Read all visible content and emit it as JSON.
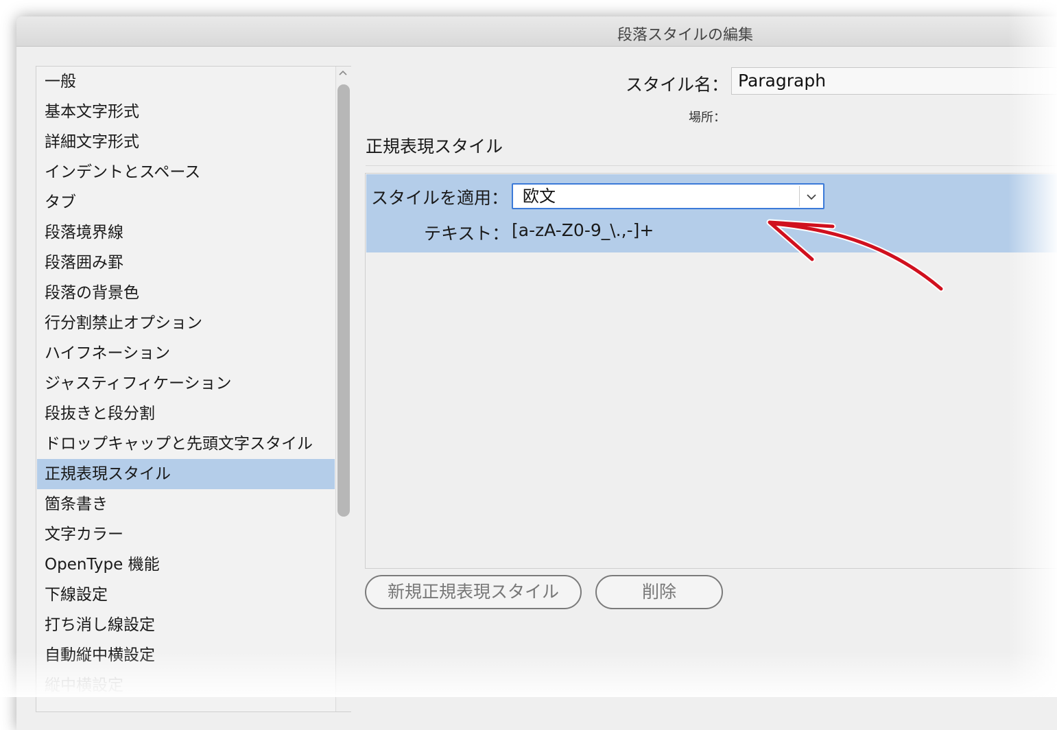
{
  "window": {
    "title": "段落スタイルの編集"
  },
  "sidebar": {
    "items": [
      {
        "label": "一般"
      },
      {
        "label": "基本文字形式"
      },
      {
        "label": "詳細文字形式"
      },
      {
        "label": "インデントとスペース"
      },
      {
        "label": "タブ"
      },
      {
        "label": "段落境界線"
      },
      {
        "label": "段落囲み罫"
      },
      {
        "label": "段落の背景色"
      },
      {
        "label": "行分割禁止オプション"
      },
      {
        "label": "ハイフネーション"
      },
      {
        "label": "ジャスティフィケーション"
      },
      {
        "label": "段抜きと段分割"
      },
      {
        "label": "ドロップキャップと先頭文字スタイル"
      },
      {
        "label": "正規表現スタイル"
      },
      {
        "label": "箇条書き"
      },
      {
        "label": "文字カラー"
      },
      {
        "label": "OpenType 機能"
      },
      {
        "label": "下線設定"
      },
      {
        "label": "打ち消し線設定"
      },
      {
        "label": "自動縦中横設定"
      },
      {
        "label": "縦中横設定"
      }
    ],
    "selected": "正規表現スタイル"
  },
  "form": {
    "style_name_label": "スタイル名：",
    "style_name_value": "Paragraph",
    "location_label": "場所："
  },
  "section": {
    "title": "正規表現スタイル",
    "rule": {
      "apply_label": "スタイルを適用：",
      "apply_value": "欧文",
      "text_label": "テキスト：",
      "text_value": "[a-zA-Z0-9_\\.,-]+"
    }
  },
  "buttons": {
    "new_label": "新規正規表現スタイル",
    "delete_label": "削除"
  },
  "colors": {
    "selection": "#b4cde9",
    "focus": "#3b7ad8",
    "annotation_arrow": "#d0101e"
  },
  "icons": {
    "scroll_up": "chevron-up-icon",
    "dropdown": "chevron-down-icon",
    "annotation": "curved-arrow-icon"
  }
}
